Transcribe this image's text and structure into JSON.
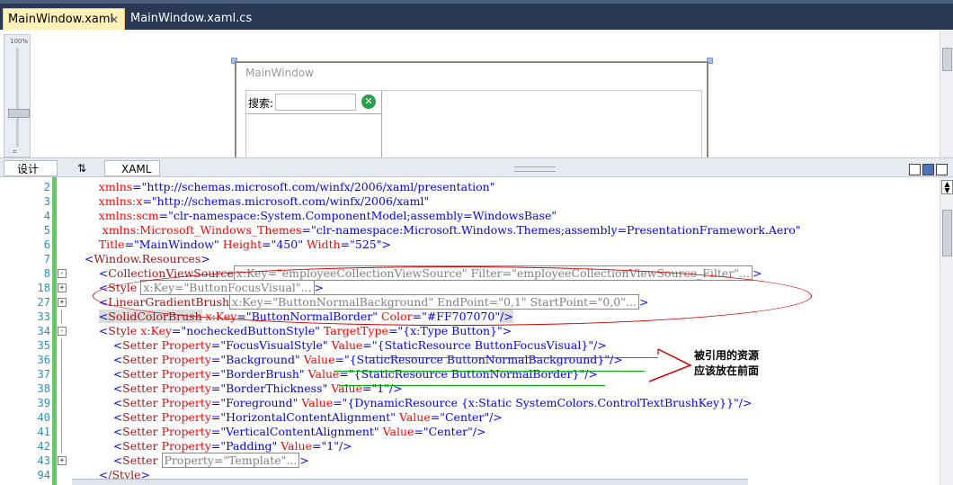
{
  "tabs": [
    {
      "label": "MainWindow.xaml",
      "close": "✕"
    },
    {
      "label": "MainWindow.xaml.cs"
    }
  ],
  "designer": {
    "zoom": "100%",
    "window_title": "MainWindow",
    "search_label": "搜索:",
    "clear_icon": "✕"
  },
  "view_tabs": {
    "design": "设计",
    "swap": "⇅",
    "xaml": "XAML"
  },
  "line_numbers": [
    "2",
    "3",
    "4",
    "5",
    "6",
    "7",
    "8",
    "18",
    "27",
    "33",
    "34",
    "35",
    "36",
    "37",
    "38",
    "39",
    "40",
    "41",
    "42",
    "43",
    "94"
  ],
  "outline_marks": [
    "",
    "",
    "",
    "",
    "",
    "",
    "-",
    "+",
    "+",
    "",
    "-",
    "",
    "",
    "",
    "",
    "",
    "",
    "",
    "",
    "+",
    ""
  ],
  "code": {
    "l2": {
      "attr": "xmlns",
      "val": "\"http://schemas.microsoft.com/winfx/2006/xaml/presentation\""
    },
    "l3": {
      "attr": "xmlns:x",
      "val": "\"http://schemas.microsoft.com/winfx/2006/xaml\""
    },
    "l4": {
      "attr": "xmlns:scm",
      "val": "\"clr-namespace:System.ComponentModel;assembly=WindowsBase\""
    },
    "l5": {
      "attr": "xmlns:Microsoft_Windows_Themes",
      "val": "\"clr-namespace:Microsoft.Windows.Themes;assembly=PresentationFramework.Aero\""
    },
    "l6": {
      "a1": "Title",
      "v1": "\"MainWindow\"",
      "a2": "Height",
      "v2": "\"450\"",
      "a3": "Width",
      "v3": "\"525\""
    },
    "l7": {
      "tag": "Window.Resources"
    },
    "l8": {
      "tag": "CollectionViewSource",
      "collapsed": "x:Key=\"employeeCollectionViewSource\" Filter=\"employeeCollectionViewSource_Filter\"..."
    },
    "l18": {
      "tag": "Style",
      "collapsed": "x:Key=\"ButtonFocusVisual\"..."
    },
    "l27": {
      "tag": "LinearGradientBrush",
      "collapsed": "x:Key=\"ButtonNormalBackground\" EndPoint=\"0,1\" StartPoint=\"0,0\"..."
    },
    "l33": {
      "tag": "SolidColorBrush",
      "a1": "x:Key",
      "v1": "\"ButtonNormalBorder\"",
      "a2": "Color",
      "v2": "\"#FF707070\""
    },
    "l34": {
      "tag": "Style",
      "a1": "x:Key",
      "v1": "\"nocheckedButtonStyle\"",
      "a2": "TargetType",
      "v2": "\"{x:Type Button}\""
    },
    "l35": {
      "tag": "Setter",
      "a1": "Property",
      "v1": "\"FocusVisualStyle\"",
      "a2": "Value",
      "v2": "\"{StaticResource ButtonFocusVisual}\""
    },
    "l36": {
      "tag": "Setter",
      "a1": "Property",
      "v1": "\"Background\"",
      "a2": "Value",
      "v2": "\"{StaticResource ButtonNormalBackground}\""
    },
    "l37": {
      "tag": "Setter",
      "a1": "Property",
      "v1": "\"BorderBrush\"",
      "a2": "Value",
      "v2": "\"{StaticResource ButtonNormalBorder}\""
    },
    "l38": {
      "tag": "Setter",
      "a1": "Property",
      "v1": "\"BorderThickness\"",
      "a2": "Value",
      "v2": "\"1\""
    },
    "l39": {
      "tag": "Setter",
      "a1": "Property",
      "v1": "\"Foreground\"",
      "a2": "Value",
      "v2": "\"{DynamicResource {x:Static SystemColors.ControlTextBrushKey}}\""
    },
    "l40": {
      "tag": "Setter",
      "a1": "Property",
      "v1": "\"HorizontalContentAlignment\"",
      "a2": "Value",
      "v2": "\"Center\""
    },
    "l41": {
      "tag": "Setter",
      "a1": "Property",
      "v1": "\"VerticalContentAlignment\"",
      "a2": "Value",
      "v2": "\"Center\""
    },
    "l42": {
      "tag": "Setter",
      "a1": "Property",
      "v1": "\"Padding\"",
      "a2": "Value",
      "v2": "\"1\""
    },
    "l43": {
      "tag": "Setter",
      "collapsed": "Property=\"Template\"..."
    },
    "l94": {
      "tag": "/Style"
    }
  },
  "annotation": {
    "line1": "被引用的资源",
    "line2": "应该放在前面"
  },
  "colors": {
    "element": "#a31515",
    "attribute": "#ff0000",
    "value": "#0000ff",
    "annotation_ellipse": "#d40000",
    "underline": "#00b000"
  }
}
